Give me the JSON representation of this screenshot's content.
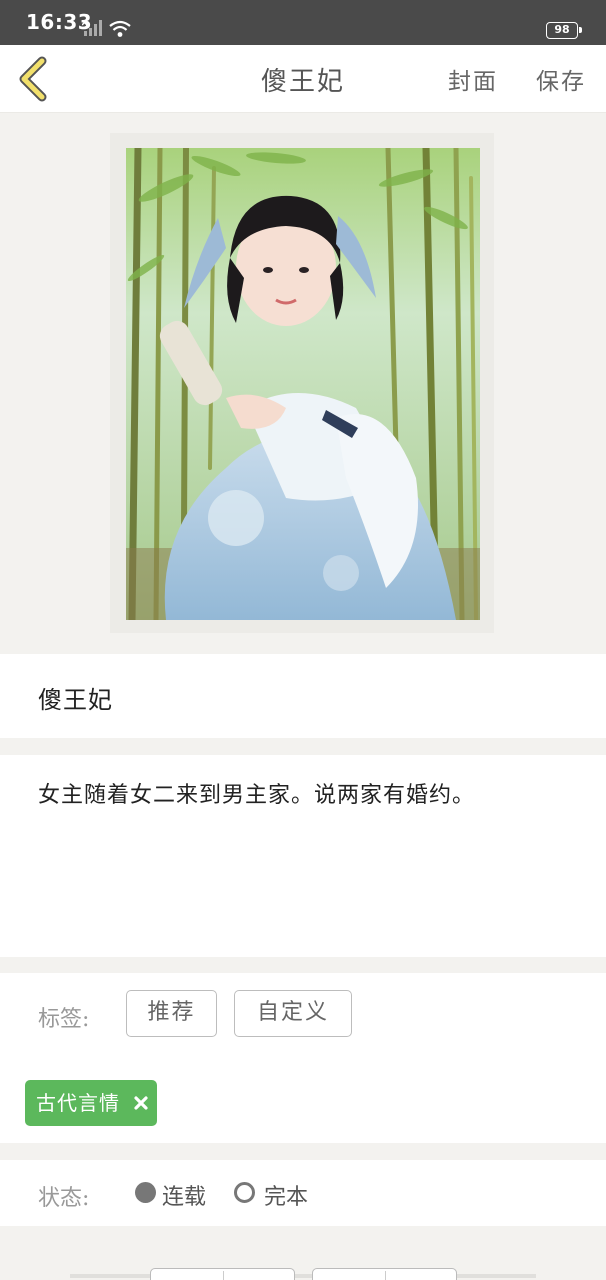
{
  "status_bar": {
    "time": "16:33",
    "battery": "98"
  },
  "nav": {
    "title": "傻王妃",
    "cover_label": "封面",
    "save_label": "保存"
  },
  "cover": {
    "alt": "cover photo of girl in light blue hanfu in bamboo grove"
  },
  "book": {
    "title": "傻王妃",
    "intro": "女主随着女二来到男主家。说两家有婚约。"
  },
  "tags": {
    "label": "标签:",
    "recommend_label": "推荐",
    "custom_label": "自定义",
    "selected": [
      "古代言情"
    ]
  },
  "status": {
    "label": "状态:",
    "options": [
      "连载",
      "完本"
    ],
    "selected": "连载"
  },
  "colors": {
    "accent": "#5cb85c",
    "back_arrow": "#f2e06b"
  }
}
